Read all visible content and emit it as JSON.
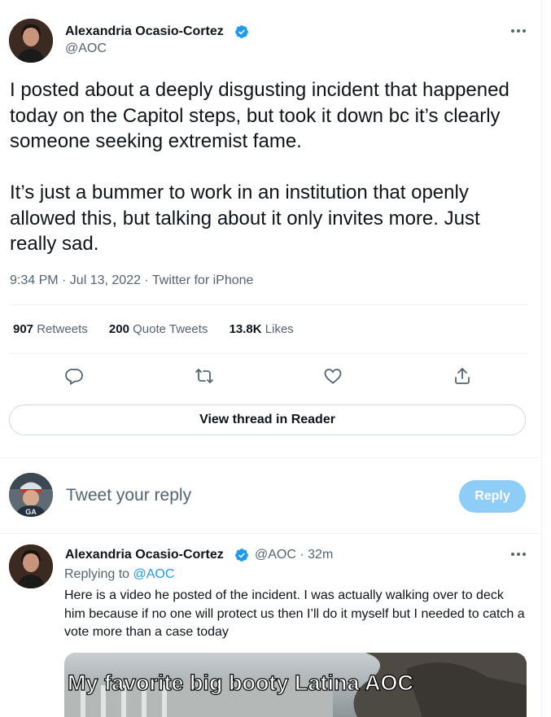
{
  "tweet": {
    "author_name": "Alexandria Ocasio-Cortez",
    "author_handle": "@AOC",
    "text": "I posted about a deeply disgusting incident that happened today on the Capitol steps, but took it down bc it’s clearly someone seeking extremist fame.\n\nIt’s just a bummer to work in an institution that openly allowed this, but talking about it only invites more. Just really sad.",
    "meta": "9:34 PM · Jul 13, 2022 · Twitter for iPhone",
    "stats": {
      "retweets_count": "907",
      "retweets_label": "Retweets",
      "quotes_count": "200",
      "quotes_label": "Quote Tweets",
      "likes_count": "13.8K",
      "likes_label": "Likes"
    },
    "reader_button": "View thread in Reader"
  },
  "composer": {
    "placeholder": "Tweet your reply",
    "reply_button": "Reply"
  },
  "reply_tweet": {
    "author_name": "Alexandria Ocasio-Cortez",
    "author_handle": "@AOC",
    "time": "· 32m",
    "replying_prefix": "Replying to",
    "replying_to": "@AOC",
    "text": "Here is a video he posted of the incident. I was actually walking over to deck him because if no one will protect us then I’ll do it myself but I needed to catch a vote more than a case today",
    "media_caption": "My favorite big booty Latina AOC"
  },
  "icons": [
    "verified-badge-icon",
    "more-icon",
    "reply-icon",
    "retweet-icon",
    "like-icon",
    "share-icon"
  ],
  "colors": {
    "accent": "#1d9bf0",
    "reply_disabled": "#8ecdf8",
    "secondary_text": "#536471"
  }
}
